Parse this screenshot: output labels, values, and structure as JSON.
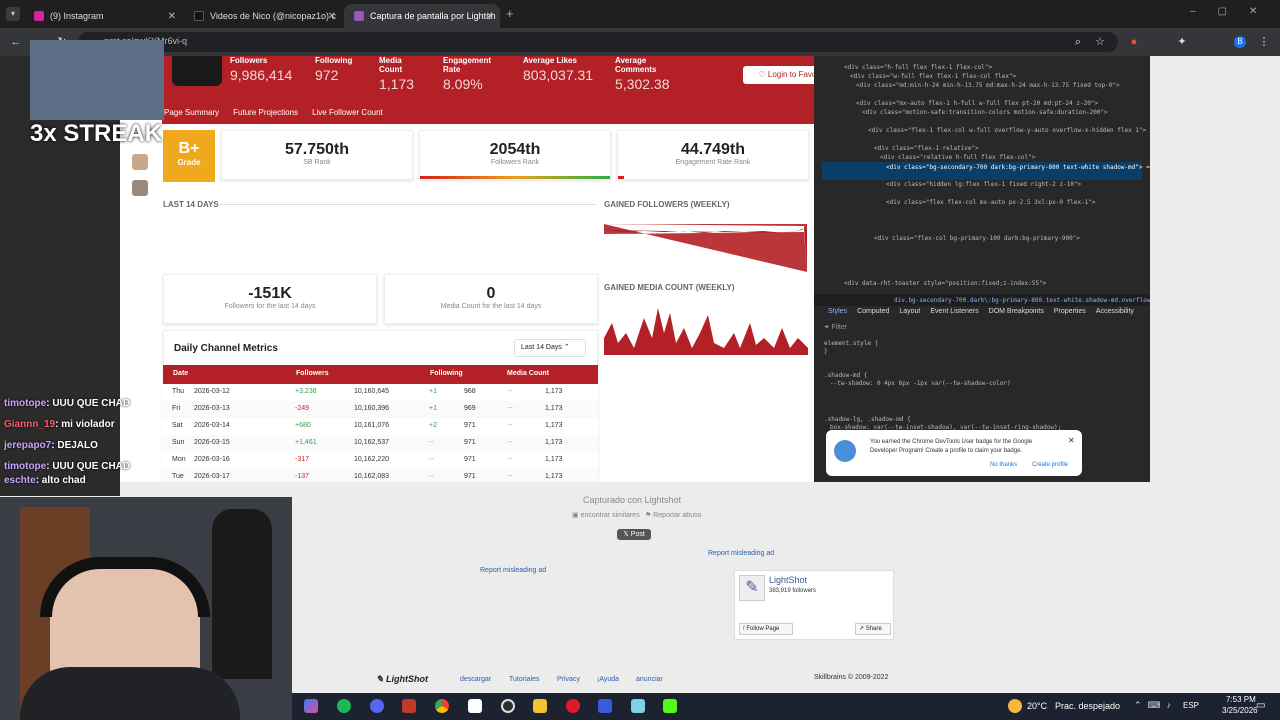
{
  "tabs": [
    {
      "label": "(9) Instagram",
      "color": "#d6249f"
    },
    {
      "label": "Videos de Nico (@nicopaz1o) c",
      "color": "#111"
    },
    {
      "label": "Captura de pantalla por Lightsh",
      "color": "#9b59b6"
    }
  ],
  "url": "prnt.sc/gwKYMr6vi-q",
  "header": {
    "stats": [
      {
        "label": "Followers",
        "value": "9,986,414"
      },
      {
        "label": "Following",
        "value": "972"
      },
      {
        "label": "Media Count",
        "value": "1,173"
      },
      {
        "label": "Engagement Rate",
        "value": "8.09%"
      },
      {
        "label": "Average Likes",
        "value": "803,037.31"
      },
      {
        "label": "Average Comments",
        "value": "5,302.38"
      }
    ],
    "login_label": "Login to Favorite",
    "nav": [
      "Page Summary",
      "Future Projections",
      "Live Follower Count"
    ]
  },
  "grade": {
    "letter": "B+",
    "label": "Grade"
  },
  "ranks": [
    {
      "value": "57.750th",
      "label": "SB Rank"
    },
    {
      "value": "2054th",
      "label": "Followers Rank"
    },
    {
      "value": "44.749th",
      "label": "Engagement Rate Rank"
    }
  ],
  "last14": "LAST 14 DAYS",
  "gained_followers": "GAINED FOLLOWERS (WEEKLY)",
  "gained_media": "GAINED MEDIA COUNT (WEEKLY)",
  "summary": [
    {
      "value": "-151K",
      "label": "Followers for the last 14 days"
    },
    {
      "value": "0",
      "label": "Media Count for the last 14 days"
    }
  ],
  "metrics": {
    "title": "Daily Channel Metrics",
    "select": "Last 14 Days",
    "headers": [
      "Date",
      "Followers",
      "Following",
      "Media Count"
    ],
    "rows": [
      {
        "day": "Thu",
        "date": "2026-03-12",
        "delta": "+3,238",
        "followers": "10,160,645",
        "fdelta": "+1",
        "following": "968",
        "mdelta": "--",
        "media": "1,173"
      },
      {
        "day": "Fri",
        "date": "2026-03-13",
        "delta": "-249",
        "followers": "10,160,396",
        "fdelta": "+1",
        "following": "969",
        "mdelta": "--",
        "media": "1,173"
      },
      {
        "day": "Sat",
        "date": "2026-03-14",
        "delta": "+680",
        "followers": "10,161,076",
        "fdelta": "+2",
        "following": "971",
        "mdelta": "--",
        "media": "1,173"
      },
      {
        "day": "Sun",
        "date": "2026-03-15",
        "delta": "+1,461",
        "followers": "10,162,537",
        "fdelta": "--",
        "following": "971",
        "mdelta": "--",
        "media": "1,173"
      },
      {
        "day": "Mon",
        "date": "2026-03-16",
        "delta": "-317",
        "followers": "10,162,220",
        "fdelta": "--",
        "following": "971",
        "mdelta": "--",
        "media": "1,173"
      },
      {
        "day": "Tue",
        "date": "2026-03-17",
        "delta": "-137",
        "followers": "10,162,083",
        "fdelta": "--",
        "following": "971",
        "mdelta": "--",
        "media": "1,173"
      }
    ]
  },
  "devtools": {
    "breadcrumb": "div.bg-secondary-700.dark\\:bg-primary-800.text-white.shadow-md.overflow-hidden",
    "tabs": [
      "Styles",
      "Computed",
      "Layout",
      "Event Listeners",
      "DOM Breakpoints",
      "Properties",
      "Accessibility"
    ],
    "filter": "Filter",
    "badge_text": "You earned the Chrome DevTools User badge for the Google Developer Program! Create a profile to claim your badge.",
    "no_thanks": "No thanks",
    "create_profile": "Create profile"
  },
  "lightshot": {
    "captured": "Capturado con Lightshot",
    "similar": "encontrar similares",
    "report": "Reportar abuso",
    "post": "Post",
    "report_ad": "Report misleading ad",
    "page_name": "LightShot",
    "page_followers": "383,919 followers",
    "follow": "Follow Page",
    "share": "Share",
    "footer": [
      "descargar",
      "Tutoriales",
      "Privacy",
      "¡Ayuda",
      "anunciar"
    ],
    "copyright": "Skillbrains © 2009-2022",
    "logo": "LightShot"
  },
  "stream": {
    "streak": "3x STREAK",
    "chat": [
      {
        "user": "timotope",
        "msg": ": UUU QUE CHAD"
      },
      {
        "user": "Giannn_19",
        "msg": ": mi violador"
      },
      {
        "user": "jerepapo7",
        "msg": ": DEJALO"
      },
      {
        "user": "timotope",
        "msg": ": UUU QUE CHAD"
      },
      {
        "user": "eschte",
        "msg": ": alto chad"
      }
    ]
  },
  "taskbar": {
    "weather": "20°C",
    "weather_desc": "Prac. despejado",
    "lang": "ESP",
    "time": "7:53 PM",
    "date": "3/25/2026"
  }
}
